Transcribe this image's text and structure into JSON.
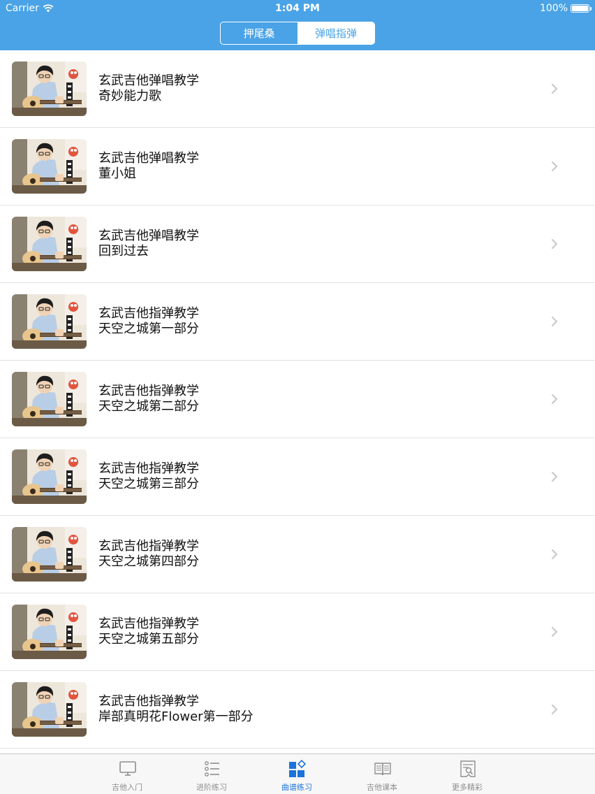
{
  "status_bar": {
    "carrier": "Carrier",
    "time": "1:04 PM",
    "battery": "100%"
  },
  "segmented_control": {
    "items": [
      {
        "label": "押尾桑",
        "selected": false
      },
      {
        "label": "弹唱指弹",
        "selected": true
      }
    ]
  },
  "list": {
    "items": [
      {
        "title": "玄武吉他弹唱教学",
        "subtitle": "奇妙能力歌"
      },
      {
        "title": "玄武吉他弹唱教学",
        "subtitle": "董小姐"
      },
      {
        "title": "玄武吉他弹唱教学",
        "subtitle": "回到过去"
      },
      {
        "title": "玄武吉他指弹教学",
        "subtitle": "天空之城第一部分"
      },
      {
        "title": "玄武吉他指弹教学",
        "subtitle": "天空之城第二部分"
      },
      {
        "title": "玄武吉他指弹教学",
        "subtitle": "天空之城第三部分"
      },
      {
        "title": "玄武吉他指弹教学",
        "subtitle": "天空之城第四部分"
      },
      {
        "title": "玄武吉他指弹教学",
        "subtitle": "天空之城第五部分"
      },
      {
        "title": "玄武吉他指弹教学",
        "subtitle": "岸部真明花Flower第一部分"
      }
    ]
  },
  "tab_bar": {
    "items": [
      {
        "label": "吉他入门",
        "icon": "monitor-icon",
        "active": false
      },
      {
        "label": "进阶练习",
        "icon": "list-icon",
        "active": false
      },
      {
        "label": "曲谱练习",
        "icon": "grid-icon",
        "active": true
      },
      {
        "label": "吉他课本",
        "icon": "book-icon",
        "active": false
      },
      {
        "label": "更多精彩",
        "icon": "document-search-icon",
        "active": false
      }
    ]
  },
  "colors": {
    "header_blue": "#4aa3e6",
    "active_tab": "#1a73d9",
    "inactive_tab": "#8e8e8e"
  }
}
